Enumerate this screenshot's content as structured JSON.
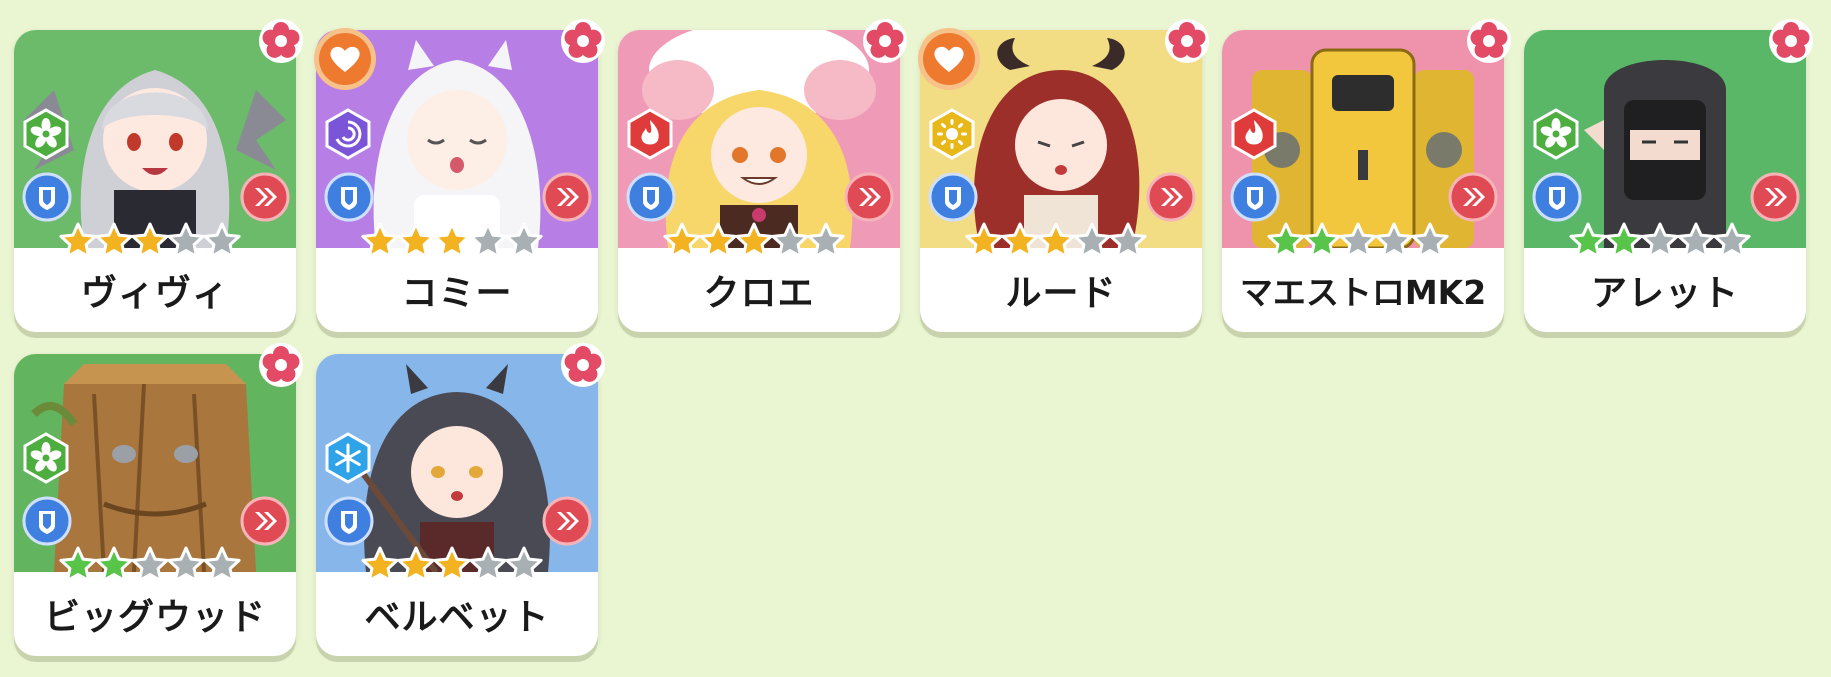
{
  "characters": [
    {
      "name": "ヴィヴィ",
      "stars": 3,
      "star_color": "gold",
      "element": "nature",
      "bg": "#6cbb6b",
      "favorite": false
    },
    {
      "name": "コミー",
      "stars": 3,
      "star_color": "gold",
      "element": "void",
      "bg": "#b77fe6",
      "favorite": true
    },
    {
      "name": "クロエ",
      "stars": 3,
      "star_color": "gold",
      "element": "fire",
      "bg": "#ef9bb8",
      "favorite": false
    },
    {
      "name": "ルード",
      "stars": 3,
      "star_color": "gold",
      "element": "light",
      "bg": "#f2dd84",
      "favorite": true
    },
    {
      "name": "マエストロMK2",
      "stars": 2,
      "star_color": "green",
      "element": "fire",
      "bg": "#ee93ab",
      "favorite": false
    },
    {
      "name": "アレット",
      "stars": 2,
      "star_color": "green",
      "element": "nature",
      "bg": "#5ab767",
      "favorite": false
    },
    {
      "name": "ビッグウッド",
      "stars": 2,
      "star_color": "green",
      "element": "nature",
      "bg": "#62b55e",
      "favorite": false
    },
    {
      "name": "ベルベット",
      "stars": 3,
      "star_color": "gold",
      "element": "ice",
      "bg": "#86b6ea",
      "favorite": false
    }
  ],
  "colors": {
    "background": "#eaf5d2",
    "flower": "#e24a66",
    "heart_badge": "#ee7a2f",
    "role_badge": "#3f7fe0",
    "arrow_badge": "#e04a55",
    "star_gold": "#f3b21f",
    "star_green": "#58c449",
    "star_empty": "#a8b0b4",
    "element_nature": "#4dae3f",
    "element_void": "#7b55d8",
    "element_fire": "#e03b3b",
    "element_light": "#e8b718",
    "element_ice": "#2fa3e8"
  },
  "icons": [
    "flower-icon",
    "heart-icon",
    "element-icon",
    "shield-icon",
    "chevron-right-icon",
    "star-icon"
  ]
}
